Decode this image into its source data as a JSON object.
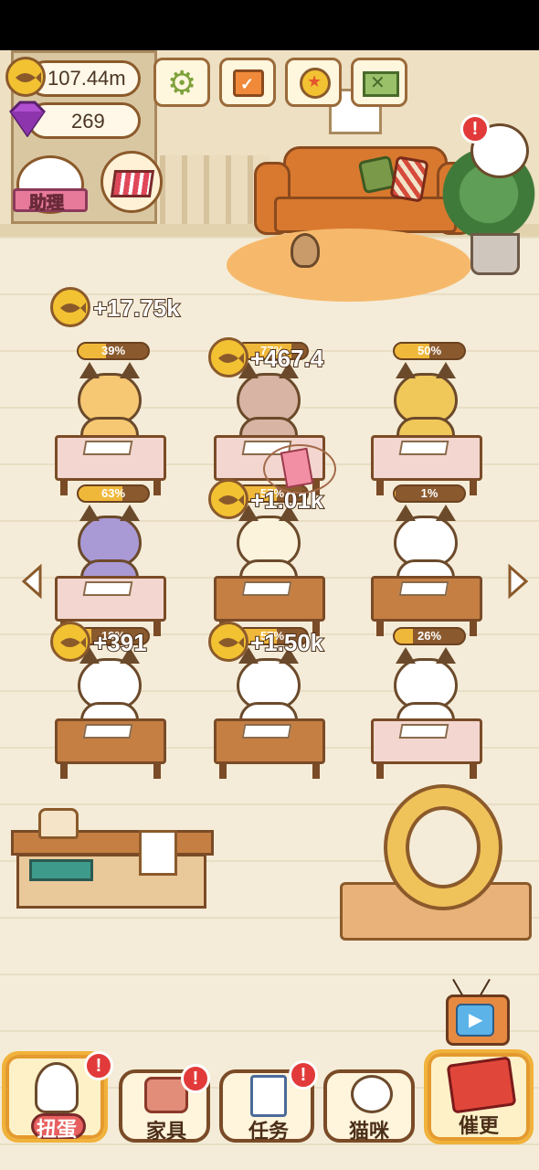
{
  "currency": {
    "fish_coins": "107.44m",
    "gems": "269"
  },
  "top_buttons": [
    "settings",
    "calendar",
    "achievements",
    "mail"
  ],
  "side_buttons": {
    "assistant_label": "助理",
    "shop_label": ""
  },
  "earnings": {
    "floating_main": "+17.75k",
    "desk_2": "+467.4",
    "desk_5": "+1.01k",
    "desk_7": "+391",
    "desk_8": "+1.50k"
  },
  "desks": [
    {
      "progress": "39%",
      "fill": 0.39
    },
    {
      "progress": "77%",
      "fill": 0.77
    },
    {
      "progress": "50%",
      "fill": 0.5
    },
    {
      "progress": "63%",
      "fill": 0.63
    },
    {
      "progress": "57%",
      "fill": 0.57
    },
    {
      "progress": "1%",
      "fill": 0.01
    },
    {
      "progress": "19%",
      "fill": 0.19
    },
    {
      "progress": "57%",
      "fill": 0.57
    },
    {
      "progress": "26%",
      "fill": 0.26
    }
  ],
  "bottom_nav": {
    "gacha": "扭蛋",
    "furniture": "家具",
    "tasks": "任务",
    "cats": "猫咪",
    "urge": "催更"
  },
  "badges": {
    "alert": "!"
  },
  "colors": {
    "coin": "#f3c232",
    "wood": "#c57f43",
    "badge": "#e23a3a",
    "progress_fill": "#f0b83a"
  }
}
